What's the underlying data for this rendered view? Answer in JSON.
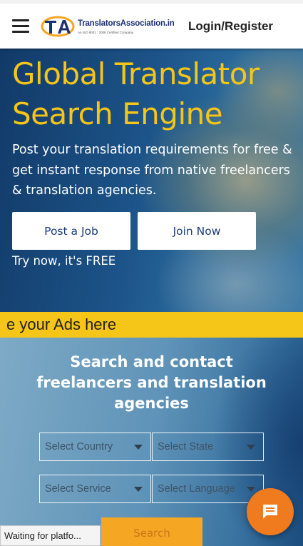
{
  "header": {
    "menu_icon": "hamburger-menu-icon",
    "logo_initials": "TA",
    "logo_name": "TranslatorsAssociation.in",
    "logo_tagline": "An ISO 9001 : 2008 Certified Company",
    "login_label": "Login/Register"
  },
  "hero": {
    "title": "Global Translator Search Engine",
    "description": "Post your translation requirements for free & get instant response from native freelancers & translation agencies.",
    "post_job_label": "Post a Job",
    "join_now_label": "Join Now",
    "try_free": "Try now, it's FREE"
  },
  "ads": {
    "text": "e your Ads here"
  },
  "search": {
    "title": "Search and contact freelancers and translation agencies",
    "country_placeholder": "Select Country",
    "state_placeholder": "Select State",
    "service_placeholder": "Select Service",
    "language_placeholder": "Select Language",
    "button_label": "Search"
  },
  "chat": {
    "icon": "chat-bubble-icon"
  },
  "browser_status": {
    "text": "Waiting for platfo..."
  },
  "colors": {
    "accent_yellow": "#f5c518",
    "brand_navy": "#1d3c78",
    "search_orange": "#f5a623",
    "chat_orange": "#f07b1f"
  }
}
